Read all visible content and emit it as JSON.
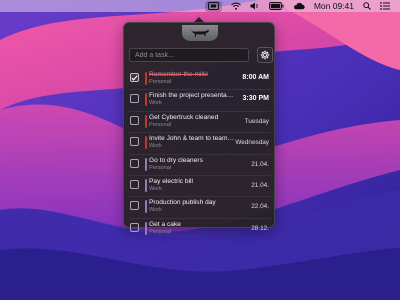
{
  "menubar": {
    "clock": "Mon 09:41",
    "icons": [
      "task-app-icon",
      "wifi-icon",
      "volume-icon",
      "battery-icon",
      "cloud-icon",
      "search-icon",
      "control-center-icon"
    ]
  },
  "popover": {
    "add_placeholder": "Add a task...",
    "settings_icon": "gear-icon"
  },
  "tasks": [
    {
      "title": "Remember the milk!",
      "list": "Personal",
      "due": "8:00 AM",
      "completed": true,
      "accent": "#c0392b"
    },
    {
      "title": "Finish the project presentation",
      "list": "Work",
      "due": "3:30 PM",
      "completed": false,
      "accent": "#c0392b"
    },
    {
      "title": "Get Cybertruck cleaned",
      "list": "Personal",
      "due": "Tuesday",
      "completed": false,
      "accent": "#c0392b"
    },
    {
      "title": "Invite John & team to teambuil...",
      "list": "Work",
      "due": "Wednesday",
      "completed": false,
      "accent": "#c0392b"
    },
    {
      "title": "Go to dry cleaners",
      "list": "Personal",
      "due": "21.04.",
      "completed": false,
      "accent": "#8e7fb8"
    },
    {
      "title": "Pay electric bill",
      "list": "Work",
      "due": "21.04.",
      "completed": false,
      "accent": "#8e7fb8"
    },
    {
      "title": "Production publish day",
      "list": "Work",
      "due": "22.04.",
      "completed": false,
      "accent": "#8e7fb8"
    },
    {
      "title": "Get a cake",
      "list": "Personal",
      "due": "28.12.",
      "completed": false,
      "accent": "#8e7fb8"
    }
  ]
}
